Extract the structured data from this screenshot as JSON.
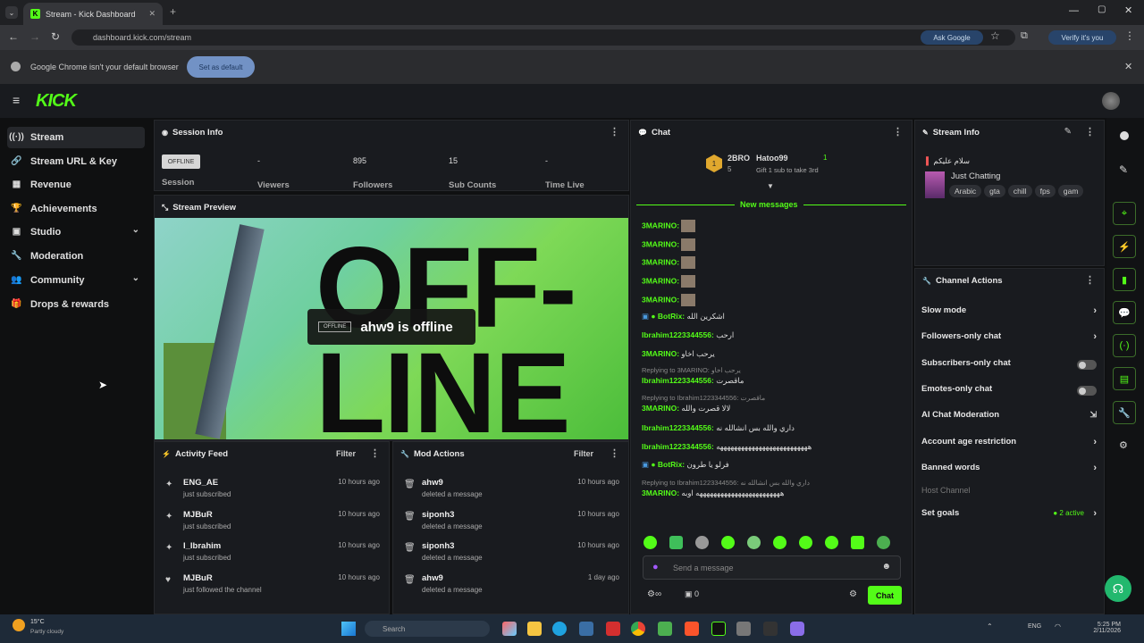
{
  "browser": {
    "tab_title": "Stream - Kick Dashboard",
    "url": "dashboard.kick.com/stream",
    "ask_google": "Ask Google",
    "verify": "Verify it's you",
    "infobar_text": "Google Chrome isn't your default browser",
    "set_default": "Set as default"
  },
  "header": {
    "logo": "KICK"
  },
  "sidebar": {
    "items": [
      {
        "label": "Stream",
        "icon": "broadcast-icon"
      },
      {
        "label": "Stream URL & Key",
        "icon": "link-icon"
      },
      {
        "label": "Revenue",
        "icon": "chart-icon"
      },
      {
        "label": "Achievements",
        "icon": "trophy-icon"
      },
      {
        "label": "Studio",
        "icon": "studio-icon"
      },
      {
        "label": "Moderation",
        "icon": "wrench-icon"
      },
      {
        "label": "Community",
        "icon": "people-icon"
      },
      {
        "label": "Drops & rewards",
        "icon": "gift-icon"
      }
    ]
  },
  "session": {
    "title": "Session Info",
    "status": "OFFLINE",
    "session_label": "Session",
    "stats": [
      {
        "value": "-",
        "label": "Viewers"
      },
      {
        "value": "895",
        "label": "Followers"
      },
      {
        "value": "15",
        "label": "Sub Counts"
      },
      {
        "value": "-",
        "label": "Time Live"
      }
    ]
  },
  "preview": {
    "title": "Stream Preview",
    "big_text_1": "OFF-",
    "big_text_2": "LINE",
    "pill": "OFFLINE",
    "message": "ahw9 is offline"
  },
  "activity": {
    "title": "Activity Feed",
    "filter": "Filter",
    "rows": [
      {
        "name": "ENG_AE",
        "sub": "just subscribed",
        "time": "10 hours ago"
      },
      {
        "name": "MJBuR",
        "sub": "just subscribed",
        "time": "10 hours ago"
      },
      {
        "name": "I_Ibrahim",
        "sub": "just subscribed",
        "time": "10 hours ago"
      },
      {
        "name": "MJBuR",
        "sub": "just followed the channel",
        "time": "10 hours ago"
      }
    ]
  },
  "mod": {
    "title": "Mod Actions",
    "filter": "Filter",
    "rows": [
      {
        "name": "ahw9",
        "sub": "deleted a message",
        "time": "10 hours ago"
      },
      {
        "name": "siponh3",
        "sub": "deleted a message",
        "time": "10 hours ago"
      },
      {
        "name": "siponh3",
        "sub": "deleted a message",
        "time": "10 hours ago"
      },
      {
        "name": "ahw9",
        "sub": "deleted a message",
        "time": "1 day ago"
      }
    ]
  },
  "chat": {
    "title": "Chat",
    "pinned_user1": "2BRO",
    "pinned_user1_count": "5",
    "pinned_user2": "Hatoo99",
    "pinned_user2_count": "1",
    "pinned_gift": "Gift 1 sub to take 3rd",
    "new_messages": "New messages",
    "lines": [
      {
        "user": "3MARINO:",
        "text": "",
        "reply": ""
      },
      {
        "user": "3MARINO:",
        "text": "",
        "reply": ""
      },
      {
        "user": "3MARINO:",
        "text": "",
        "reply": ""
      },
      {
        "user": "3MARINO:",
        "text": "",
        "reply": ""
      },
      {
        "user": "3MARINO:",
        "text": "",
        "reply": ""
      },
      {
        "user": "BotRix:",
        "text": "اشكرين الله",
        "reply": ""
      },
      {
        "user": "Ibrahim1223344556:",
        "text": "ارحب",
        "reply": ""
      },
      {
        "user": "3MARINO:",
        "text": "يرحب اخاو",
        "reply": ""
      },
      {
        "user": "Ibrahim1223344556:",
        "text": "ماقصرت",
        "reply": "Replying to 3MARINO: يرحب اخاو"
      },
      {
        "user": "3MARINO:",
        "text": "لالا قصرت والله",
        "reply": "Replying to Ibrahim1223344556: ماقصرت"
      },
      {
        "user": "Ibrahim1223344556:",
        "text": "داري والله بس انشالله نه",
        "reply": ""
      },
      {
        "user": "Ibrahim1223344556:",
        "text": "ههههههههههههههههههههههههههه",
        "reply": ""
      },
      {
        "user": "BotRix:",
        "text": "فرلو يا طرون",
        "reply": ""
      },
      {
        "user": "3MARINO:",
        "text": "ههههههههههههههههههههههههه اوبه",
        "reply": "Replying to Ibrahim1223344556: داري والله بس انشالله نه"
      }
    ],
    "input_placeholder": "Send a message",
    "viewers_count": "0",
    "chat_button": "Chat"
  },
  "stream_info": {
    "title": "Stream Info",
    "stream_title": "سلام عليكم",
    "category": "Just Chatting",
    "tags": [
      "Arabic",
      "gta",
      "chill",
      "fps",
      "gam"
    ]
  },
  "channel_actions": {
    "title": "Channel Actions",
    "rows": [
      {
        "label": "Slow mode",
        "control": "chevron"
      },
      {
        "label": "Followers-only chat",
        "control": "chevron"
      },
      {
        "label": "Subscribers-only chat",
        "control": "toggle"
      },
      {
        "label": "Emotes-only chat",
        "control": "toggle"
      },
      {
        "label": "AI Chat Moderation",
        "control": "ext"
      },
      {
        "label": "Account age restriction",
        "control": "chevron"
      },
      {
        "label": "Banned words",
        "control": "chevron"
      },
      {
        "label": "Host Channel",
        "control": "none"
      },
      {
        "label": "Set goals",
        "control": "chevron"
      }
    ],
    "goals_status": "2 active"
  },
  "taskbar": {
    "weather": "15°C",
    "weather_sub": "Partly cloudy",
    "search": "Search",
    "time": "5:25 PM",
    "date": "2/11/2026",
    "lang": "ENG"
  },
  "colors": {
    "accent": "#53fc18",
    "panel": "#191b1f",
    "bg": "#0f1011"
  }
}
